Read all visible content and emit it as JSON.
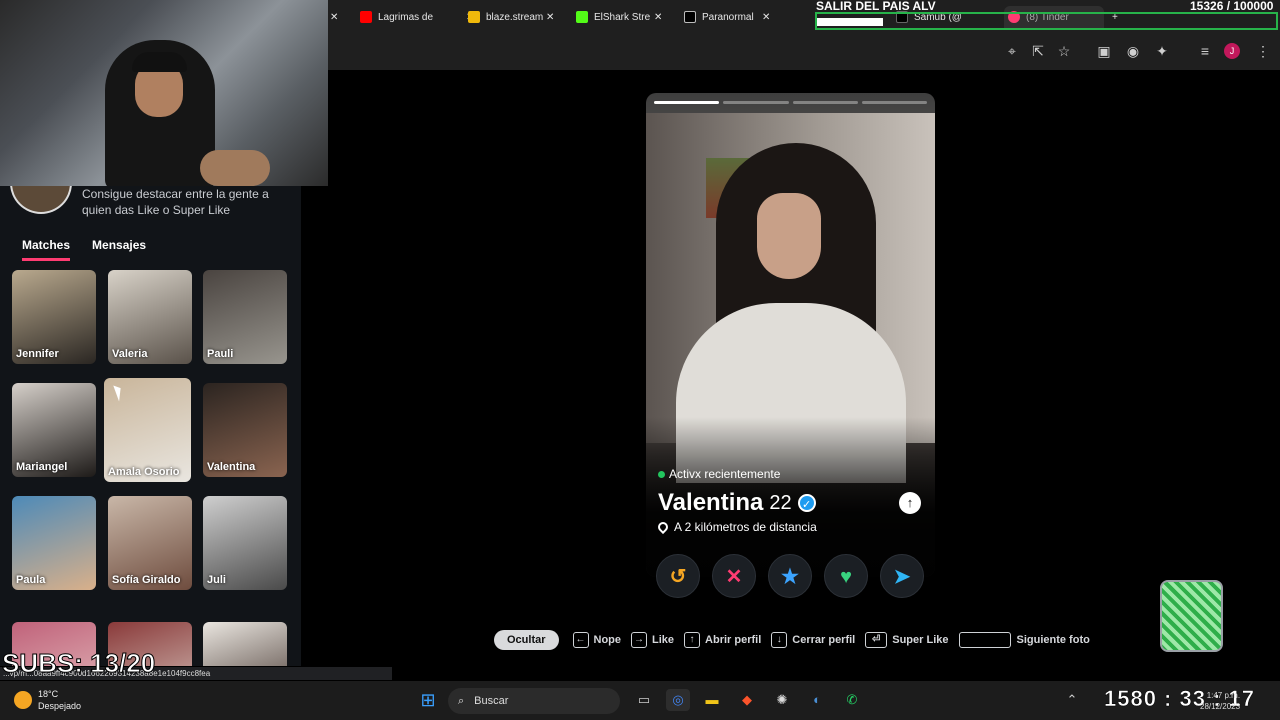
{
  "overlay": {
    "title": "SALIR DEL PAIS ALV",
    "counter": "15326  / 100000",
    "subs": "SUBS: 13/20"
  },
  "tabs": [
    {
      "label": "Lagrimas de",
      "color": "#ff0000"
    },
    {
      "label": "blaze.stream",
      "color": "#f0b90b"
    },
    {
      "label": "ElShark Stre",
      "color": "#53fc18"
    },
    {
      "label": "Paranormal",
      "color": "#111111"
    },
    {
      "label": "Samub (@",
      "color": "#111111"
    },
    {
      "label": "(8) Tinder",
      "color": "#fe3c72"
    }
  ],
  "sidebar": {
    "promo": "Consigue destacar entre la gente a quien das Like o Super Like",
    "tab_matches": "Matches",
    "tab_messages": "Mensajes",
    "matches": [
      {
        "name": "Jennifer",
        "c1": "#b9a98e",
        "c2": "#2a2622"
      },
      {
        "name": "Valeria",
        "c1": "#d8d2c8",
        "c2": "#5a524a"
      },
      {
        "name": "Pauli",
        "c1": "#4a4440",
        "c2": "#98958e"
      },
      {
        "name": "Mariangel",
        "c1": "#d6d0ca",
        "c2": "#1d1a18"
      },
      {
        "name": "Amala Osorio",
        "c1": "#c9b59a",
        "c2": "#e9e6e0"
      },
      {
        "name": "Valentina",
        "c1": "#2b2420",
        "c2": "#8a6450"
      },
      {
        "name": "Paula",
        "c1": "#4d8ab8",
        "c2": "#d9b08a"
      },
      {
        "name": "Sofía Giraldo",
        "c1": "#c9b7a8",
        "c2": "#6e4c3e"
      },
      {
        "name": "Juli",
        "c1": "#cfcfcf",
        "c2": "#4a4a4a"
      },
      {
        "name": "",
        "c1": "#c0627a",
        "c2": "#e5c0c0"
      },
      {
        "name": "",
        "c1": "#8a3a3a",
        "c2": "#d8c8c0"
      },
      {
        "name": "",
        "c1": "#eae6e0",
        "c2": "#3a2a24"
      }
    ]
  },
  "status_url": "...vp/m...08aa9ff4c900d1662269314238a8e1e104f9cc8fea",
  "profile": {
    "status": "Activx recientemente",
    "name": "Valentina",
    "age": "22",
    "distance": "A 2 kilómetros de distancia",
    "photo_count": 4,
    "photo_index": 0
  },
  "shortcuts": {
    "hide": "Ocultar",
    "nope": "Nope",
    "like": "Like",
    "open": "Abrir perfil",
    "close": "Cerrar perfil",
    "superlike": "Super Like",
    "next": "Siguiente foto"
  },
  "taskbar": {
    "temp": "18°C",
    "weather": "Despejado",
    "search": "Buscar",
    "clock_overlay": "1580 : 33 : 17",
    "time": "1:47 p.m.",
    "date": "28/12/2023"
  }
}
